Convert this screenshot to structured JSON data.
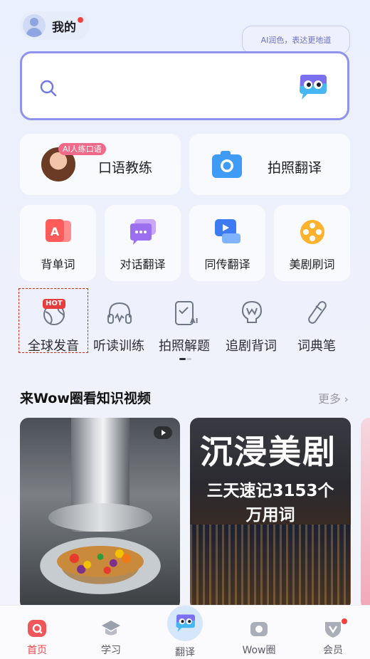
{
  "header": {
    "me_label": "我的",
    "bubble_text": "AI润色，表达更地道"
  },
  "big_cards": [
    {
      "label": "口语教练",
      "badge": "AI人练口语"
    },
    {
      "label": "拍照翻译"
    }
  ],
  "small_cards": [
    {
      "label": "背单词"
    },
    {
      "label": "对话翻译"
    },
    {
      "label": "同传翻译"
    },
    {
      "label": "美剧刷词"
    }
  ],
  "tools": [
    {
      "label": "全球发音",
      "badge": "HOT"
    },
    {
      "label": "听读训练"
    },
    {
      "label": "拍照解题"
    },
    {
      "label": "追剧背词"
    },
    {
      "label": "词典笔"
    }
  ],
  "section": {
    "title": "来Wow圈看知识视频",
    "more": "更多"
  },
  "videos": [
    {
      "overlay_title": "",
      "overlay_sub": ""
    },
    {
      "overlay_title": "沉浸美剧",
      "overlay_sub": "三天速记3153个\n万用词"
    }
  ],
  "tabbar": [
    {
      "label": "首页",
      "active": true
    },
    {
      "label": "学习"
    },
    {
      "label": "翻译"
    },
    {
      "label": "Wow圈"
    },
    {
      "label": "会员"
    }
  ],
  "colors": {
    "accent": "#f04a4a",
    "search_border": "#8f93ee",
    "hot_red": "#e83c3c"
  }
}
